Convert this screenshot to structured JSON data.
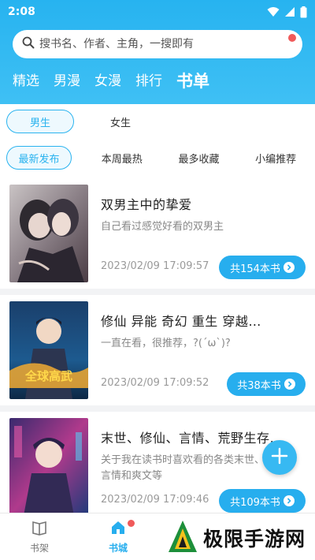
{
  "status_bar": {
    "time": "2:08"
  },
  "search": {
    "placeholder": "搜书名、作者、主角，一搜即有"
  },
  "nav_tabs": [
    {
      "label": "精选"
    },
    {
      "label": "男漫"
    },
    {
      "label": "女漫"
    },
    {
      "label": "排行"
    },
    {
      "label": "书单",
      "active": true
    }
  ],
  "gender_tabs": [
    {
      "label": "男生",
      "active": true
    },
    {
      "label": "女生"
    }
  ],
  "sort_tabs": [
    {
      "label": "最新发布",
      "active": true
    },
    {
      "label": "本周最热"
    },
    {
      "label": "最多收藏"
    },
    {
      "label": "小编推荐"
    }
  ],
  "books": [
    {
      "title": "双男主中的挚爱",
      "description": "自己看过感觉好看的双男主",
      "date": "2023/02/09 17:09:57",
      "count_label": "共154本书"
    },
    {
      "title": "修仙  异能  奇幻  重生  穿越…",
      "description": "一直在看，很推荐，?(´ω`)?",
      "date": "2023/02/09 17:09:52",
      "count_label": "共38本书"
    },
    {
      "title": "末世、修仙、言情、荒野生存…",
      "description": "关于我在读书时喜欢看的各类末世、都市、言情和爽文等",
      "date": "2023/02/09 17:09:46",
      "count_label": "共109本书"
    }
  ],
  "bottom_nav": [
    {
      "label": "书架",
      "icon": "bookshelf-icon"
    },
    {
      "label": "书城",
      "icon": "bookstore-icon",
      "active": true
    }
  ],
  "watermark": {
    "text": "极限手游网"
  },
  "colors": {
    "accent": "#27aeee",
    "badge": "#f05a5a"
  }
}
